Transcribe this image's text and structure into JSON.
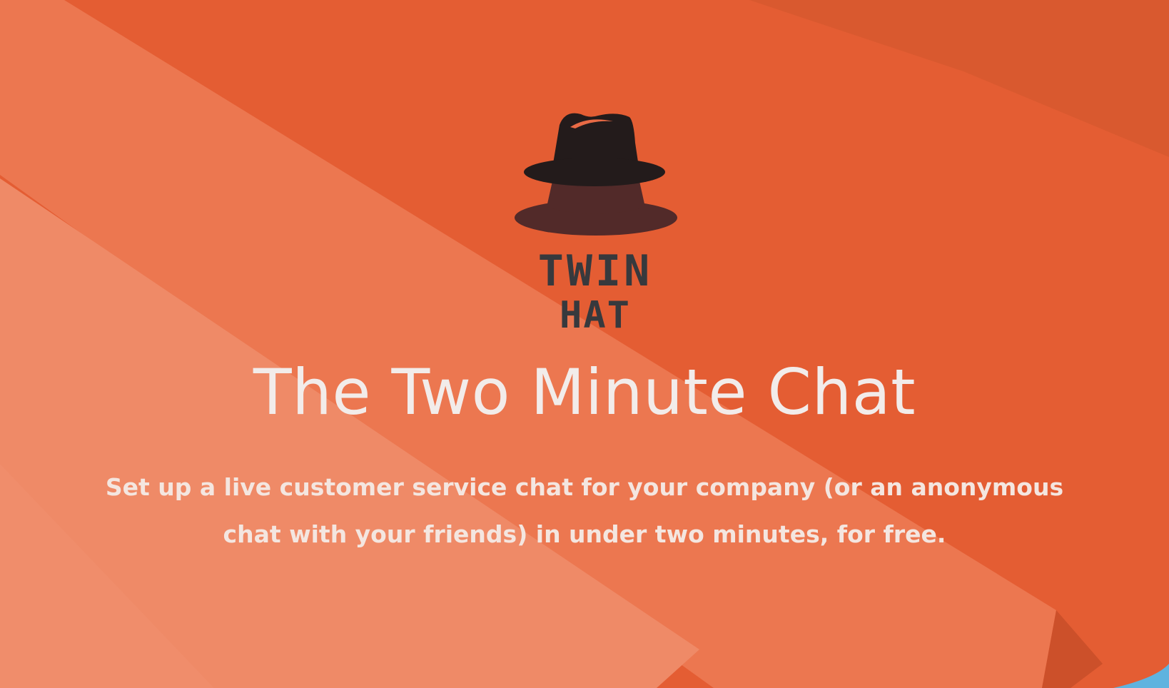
{
  "hero": {
    "logo": {
      "icon": "fedora-hat-icon",
      "word_line1": "TWIN",
      "word_line2": "HAT"
    },
    "title": "The Two Minute Chat",
    "subtitle": "Set up a live customer service chat for your company (or an anonymous chat with your friends) in under two minutes, for free."
  },
  "colors": {
    "background": "#e45d33",
    "title_text": "#f2ecea",
    "logo_hat": "#231b1b",
    "logo_shadow": "#522a29",
    "logo_text": "#37393d"
  }
}
